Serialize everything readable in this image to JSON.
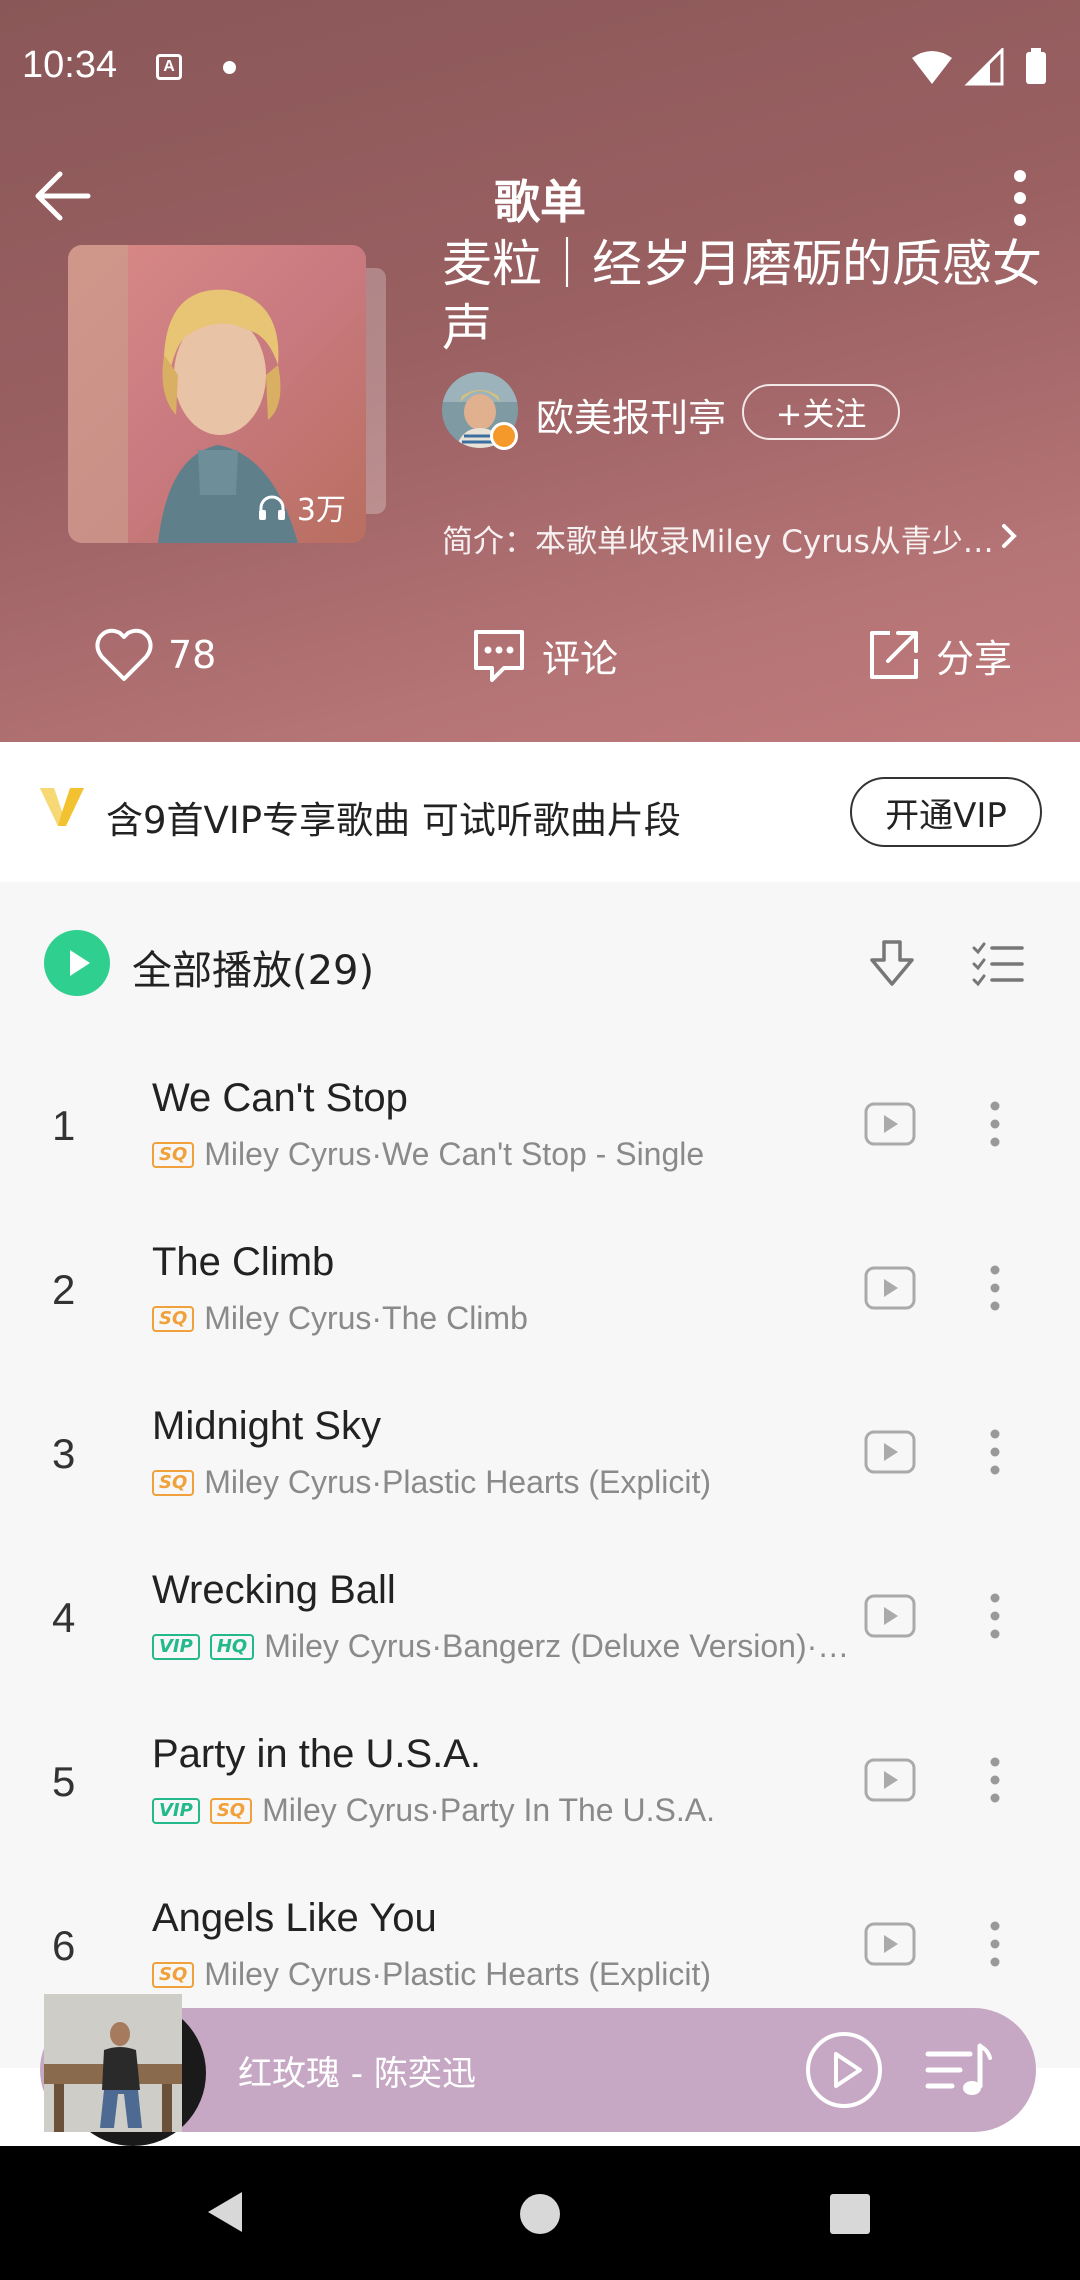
{
  "status_bar": {
    "time": "10:34",
    "notification_icon_letter": "A"
  },
  "header": {
    "title": "歌单"
  },
  "playlist": {
    "title": "麦粒｜经岁月磨砺的质感女声",
    "play_count": "3万",
    "creator": "欧美报刊亭",
    "follow_label": "+关注",
    "intro": "简介：本歌单收录Miley Cyrus从青少…"
  },
  "actions": {
    "likes": "78",
    "comment_label": "评论",
    "share_label": "分享"
  },
  "vip_banner": {
    "text": "含9首VIP专享歌曲 可试听歌曲片段",
    "button_label": "开通VIP"
  },
  "play_all": {
    "label": "全部播放(29)"
  },
  "songs": [
    {
      "num": "1",
      "title": "We Can't Stop",
      "tags": [
        "SQ"
      ],
      "meta": "Miley Cyrus·We Can't Stop - Single"
    },
    {
      "num": "2",
      "title": "The Climb",
      "tags": [
        "SQ"
      ],
      "meta": "Miley Cyrus·The Climb"
    },
    {
      "num": "3",
      "title": "Midnight Sky",
      "tags": [
        "SQ"
      ],
      "meta": "Miley Cyrus·Plastic Hearts (Explicit)"
    },
    {
      "num": "4",
      "title": "Wrecking Ball",
      "tags": [
        "VIP",
        "HQ"
      ],
      "meta": "Miley Cyrus·Bangerz (Deluxe Version)·…"
    },
    {
      "num": "5",
      "title": "Party in the U.S.A.",
      "tags": [
        "VIP",
        "SQ"
      ],
      "meta": "Miley Cyrus·Party In The U.S.A."
    },
    {
      "num": "6",
      "title": "Angels Like You",
      "tags": [
        "SQ"
      ],
      "meta": "Miley Cyrus·Plastic Hearts (Explicit)"
    }
  ],
  "mini_player": {
    "now_playing": "红玫瑰 - 陈奕迅"
  },
  "colors": {
    "accent_green": "#2fcf8f",
    "sq_tag": "#f0a13b",
    "vip_tag": "#23b98b",
    "mini_player_bg": "#c6a8c4"
  },
  "icons": [
    "back-arrow-icon",
    "more-vertical-icon",
    "headphones-icon",
    "heart-icon",
    "comment-icon",
    "share-icon",
    "vip-logo-icon",
    "play-icon",
    "download-icon",
    "multi-select-icon",
    "mv-play-icon",
    "playlist-queue-icon"
  ]
}
